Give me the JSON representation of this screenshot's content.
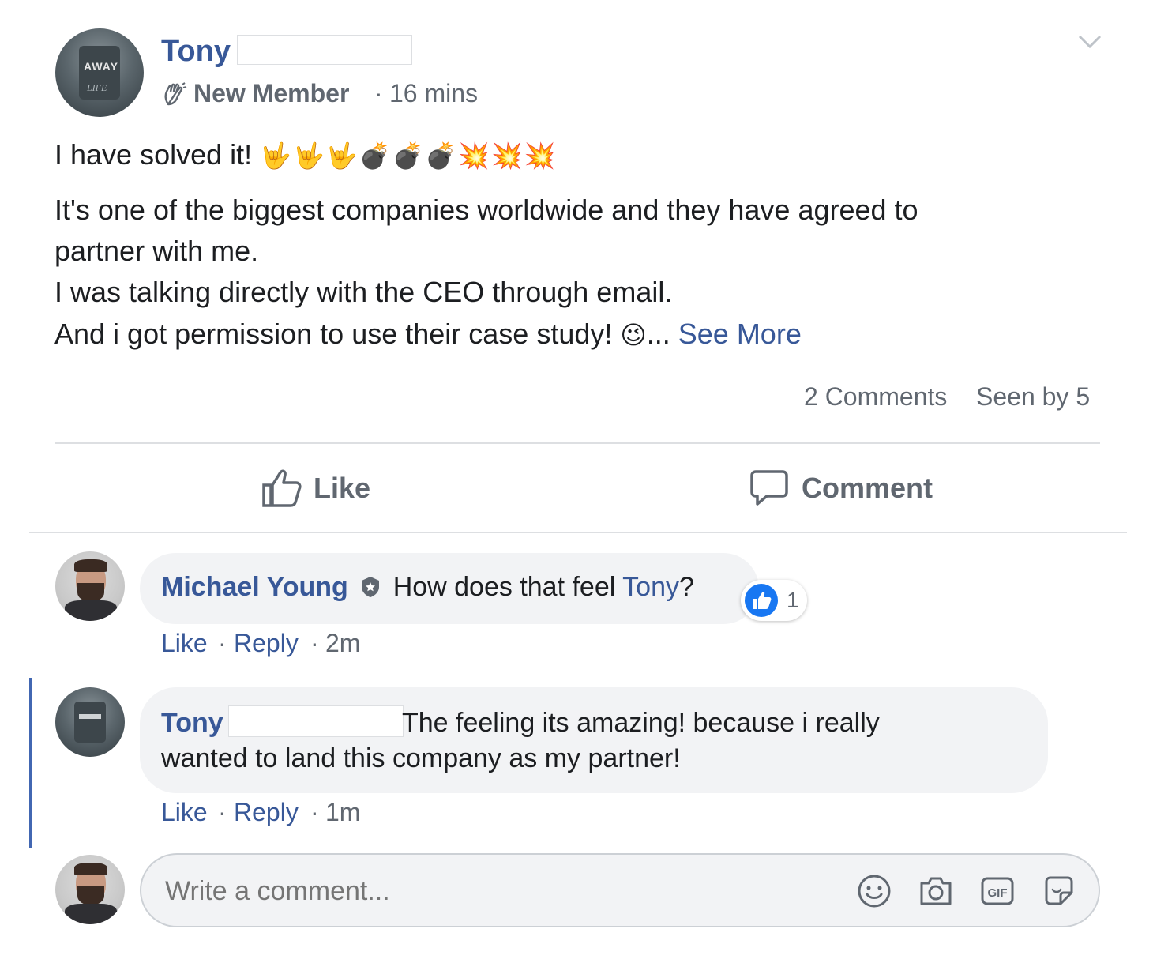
{
  "post": {
    "author_first": "Tony",
    "badge": "New Member",
    "sep": "·",
    "time": "16 mins",
    "line1": "I have solved it!",
    "line1_emoji": "🤟🤟🤟💣💣💣💥💥💥",
    "line2": "It's one of the biggest companies worldwide and they have agreed to",
    "line3": "partner with me.",
    "line4": "I was talking directly with the CEO through email.",
    "line5": "And i got permission to use their case study!",
    "line5_emoji": "😉",
    "ellipsis": "...",
    "see_more": "See More",
    "comments_count": "2 Comments",
    "seen_by": "Seen by 5"
  },
  "actions": {
    "like": "Like",
    "comment": "Comment"
  },
  "comments": [
    {
      "author": "Michael Young",
      "text": "How does that feel",
      "mention": "Tony",
      "punct": "?",
      "reaction_count": "1",
      "like": "Like",
      "reply": "Reply",
      "sep": "·",
      "time": "2m"
    },
    {
      "author": "Tony",
      "text1": "The feeling its amazing! because i really",
      "text2": "wanted to land this company as my partner!",
      "like": "Like",
      "reply": "Reply",
      "sep": "·",
      "time": "1m"
    }
  ],
  "composer": {
    "placeholder": "Write a comment..."
  },
  "avatar_text": {
    "line1": "AWAY",
    "line2": "LIFE"
  },
  "colors": {
    "link": "#385898",
    "muted": "#606770",
    "bubble": "#f2f3f5",
    "like_blue": "#1877f2",
    "thread": "#4267b2"
  },
  "icons": [
    "chevron-down-icon",
    "wave-hand-icon",
    "verified-icon",
    "thumbs-up-icon",
    "speech-bubble-icon",
    "emoji-icon",
    "camera-icon",
    "gif-icon",
    "sticker-icon"
  ]
}
